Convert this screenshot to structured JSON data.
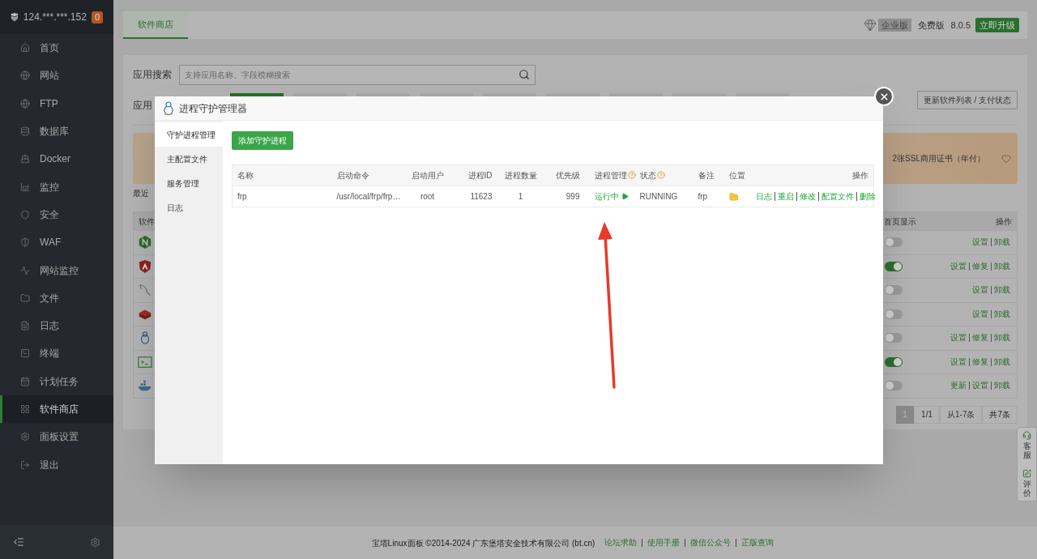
{
  "sidebar": {
    "host": "124.***.***.152",
    "badge": "0",
    "items": [
      {
        "label": "首页",
        "selected": false
      },
      {
        "label": "网站",
        "selected": false
      },
      {
        "label": "FTP",
        "selected": false
      },
      {
        "label": "数据库",
        "selected": false
      },
      {
        "label": "Docker",
        "selected": false
      },
      {
        "label": "监控",
        "selected": false
      },
      {
        "label": "安全",
        "selected": false
      },
      {
        "label": "WAF",
        "selected": false
      },
      {
        "label": "网站监控",
        "selected": false
      },
      {
        "label": "文件",
        "selected": false
      },
      {
        "label": "日志",
        "selected": false
      },
      {
        "label": "终端",
        "selected": false
      },
      {
        "label": "计划任务",
        "selected": false
      },
      {
        "label": "软件商店",
        "selected": true
      },
      {
        "label": "面板设置",
        "selected": false
      },
      {
        "label": "退出",
        "selected": false
      }
    ]
  },
  "topbar": {
    "tabs": [
      {
        "label": "软件商店",
        "selected": true
      }
    ],
    "edition_badge": "企业版",
    "edition": "免费版",
    "version": "8.0.5",
    "upgrade_button": "立即升级"
  },
  "search": {
    "label": "应用搜索",
    "placeholder": "支持应用名称、字段模糊搜索"
  },
  "category": {
    "label": "应用",
    "tabs": [
      {
        "selected": true
      },
      {
        "selected": false
      },
      {
        "selected": false
      },
      {
        "selected": false
      },
      {
        "selected": false
      },
      {
        "selected": false
      },
      {
        "selected": false
      },
      {
        "selected": false
      },
      {
        "selected": false
      }
    ]
  },
  "update_button": "更新软件列表 / 支付状态",
  "banner": {
    "promo": "2张SSL商用证书（年付）",
    "recent_label": "最近"
  },
  "table": {
    "header_left": "软件",
    "header_display": "首页显示",
    "header_action": "操作",
    "rows": [
      {
        "on": false,
        "actions": [
          "设置",
          "卸载"
        ]
      },
      {
        "on": true,
        "actions": [
          "设置",
          "修复",
          "卸载"
        ]
      },
      {
        "on": false,
        "actions": [
          "设置",
          "卸载"
        ]
      },
      {
        "on": false,
        "actions": [
          "设置",
          "卸载"
        ]
      },
      {
        "on": false,
        "actions": [
          "设置",
          "修复",
          "卸载"
        ]
      },
      {
        "on": true,
        "actions": [
          "设置",
          "修复",
          "卸载"
        ]
      },
      {
        "on": false,
        "actions": [
          "更新",
          "设置",
          "卸载"
        ]
      }
    ]
  },
  "pagination": {
    "pages": [
      {
        "label": "1",
        "selected": true
      }
    ],
    "page_count": "1/1",
    "range": "从1-7条",
    "total": "共7条"
  },
  "modal": {
    "title": "进程守护管理器",
    "nav": [
      {
        "label": "守护进程管理",
        "selected": true
      },
      {
        "label": "主配置文件",
        "selected": false
      },
      {
        "label": "服务管理",
        "selected": false
      },
      {
        "label": "日志",
        "selected": false
      }
    ],
    "add_button": "添加守护进程",
    "columns": [
      {
        "label": "名称",
        "help": false
      },
      {
        "label": "启动命令",
        "help": false
      },
      {
        "label": "启动用户",
        "help": false
      },
      {
        "label": "进程ID",
        "help": false
      },
      {
        "label": "进程数量",
        "help": false
      },
      {
        "label": "优先级",
        "help": false
      },
      {
        "label": "进程管理",
        "help": true
      },
      {
        "label": "状态",
        "help": true
      },
      {
        "label": "备注",
        "help": false
      },
      {
        "label": "位置",
        "help": false
      },
      {
        "label": "操作",
        "help": false
      }
    ],
    "rows": [
      {
        "name": "frp",
        "command": "/usr/local/frp/frp…",
        "user": "root",
        "pid": "11623",
        "count": "1",
        "priority": "999",
        "manage": "运行中",
        "running": true,
        "status": "RUNNING",
        "note": "frp",
        "actions": [
          "日志",
          "重启",
          "修改",
          "配置文件",
          "删除"
        ]
      }
    ]
  },
  "footer": {
    "copyright": "宝塔Linux面板 ©2014-2024 广东堡塔安全技术有限公司 (bt.cn)",
    "links": [
      "论坛求助",
      "使用手册",
      "微信公众号",
      "正版查询"
    ]
  },
  "float_widget": [
    {
      "label": "客服"
    },
    {
      "label": "评价"
    }
  ]
}
